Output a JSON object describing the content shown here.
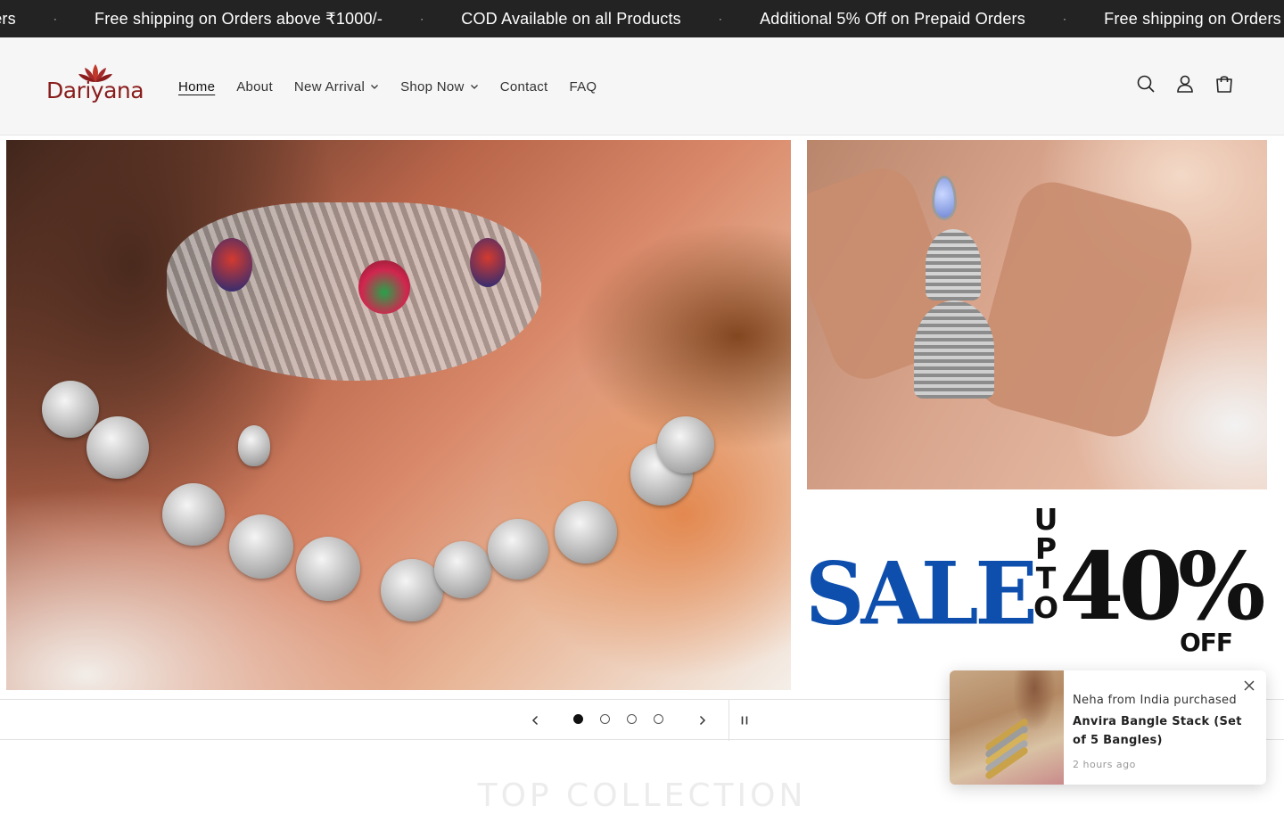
{
  "announcement": {
    "items": [
      "ders",
      "Free shipping on Orders above ₹1000/-",
      "COD Available on all Products",
      "Additional 5% Off on Prepaid Orders",
      "Free shipping on Orders"
    ],
    "separator": "·"
  },
  "header": {
    "logo_text": "Dariyana",
    "nav": [
      {
        "label": "Home",
        "active": true
      },
      {
        "label": "About"
      },
      {
        "label": "New Arrival",
        "dropdown": true
      },
      {
        "label": "Shop Now",
        "dropdown": true
      },
      {
        "label": "Contact"
      },
      {
        "label": "FAQ"
      }
    ],
    "icons": [
      "search-icon",
      "account-icon",
      "cart-icon"
    ],
    "brand_color": "#8a1c1c"
  },
  "hero": {
    "banner": {
      "sale_word": "SALE",
      "upto_letters": [
        "U",
        "P",
        "T",
        "O"
      ],
      "percent": "40%",
      "off": "OFF",
      "sale_color": "#0e4fae"
    },
    "slider": {
      "slide_count": 4,
      "active_index": 0
    }
  },
  "section": {
    "title": "TOP COLLECTION"
  },
  "toast": {
    "line1": "Neha from India purchased",
    "product": "Anvira Bangle Stack (Set of 5 Bangles)",
    "time": "2 hours ago"
  }
}
